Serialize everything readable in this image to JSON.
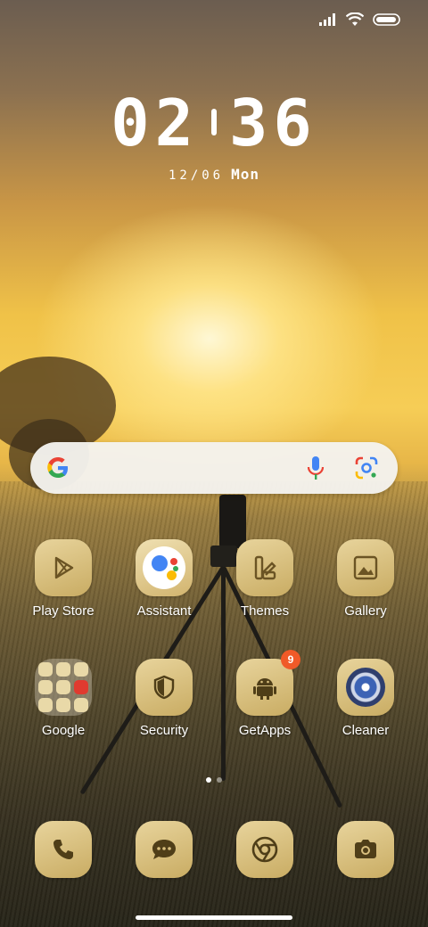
{
  "status_bar": {
    "icons": [
      "signal-icon",
      "wifi-icon",
      "battery-icon"
    ]
  },
  "clock": {
    "hours": "02",
    "minutes": "36",
    "date": "12/06",
    "day": "Mon"
  },
  "search_bar": {
    "icons": [
      "google-logo-icon",
      "microphone-icon",
      "google-lens-icon"
    ]
  },
  "apps_row1": [
    {
      "label": "Play Store"
    },
    {
      "label": "Assistant"
    },
    {
      "label": "Themes"
    },
    {
      "label": "Gallery"
    }
  ],
  "apps_row2": [
    {
      "label": "Google"
    },
    {
      "label": "Security"
    },
    {
      "label": "GetApps",
      "badge": "9"
    },
    {
      "label": "Cleaner"
    }
  ],
  "dock": [
    {
      "icon": "phone-icon"
    },
    {
      "icon": "messages-icon"
    },
    {
      "icon": "chrome-icon"
    },
    {
      "icon": "camera-icon"
    }
  ],
  "page_indicator": {
    "pages": 2,
    "active": 1
  },
  "colors": {
    "icon_bg": "#d9bf7e",
    "icon_glyph": "#6b5424",
    "badge": "#f05a28"
  }
}
